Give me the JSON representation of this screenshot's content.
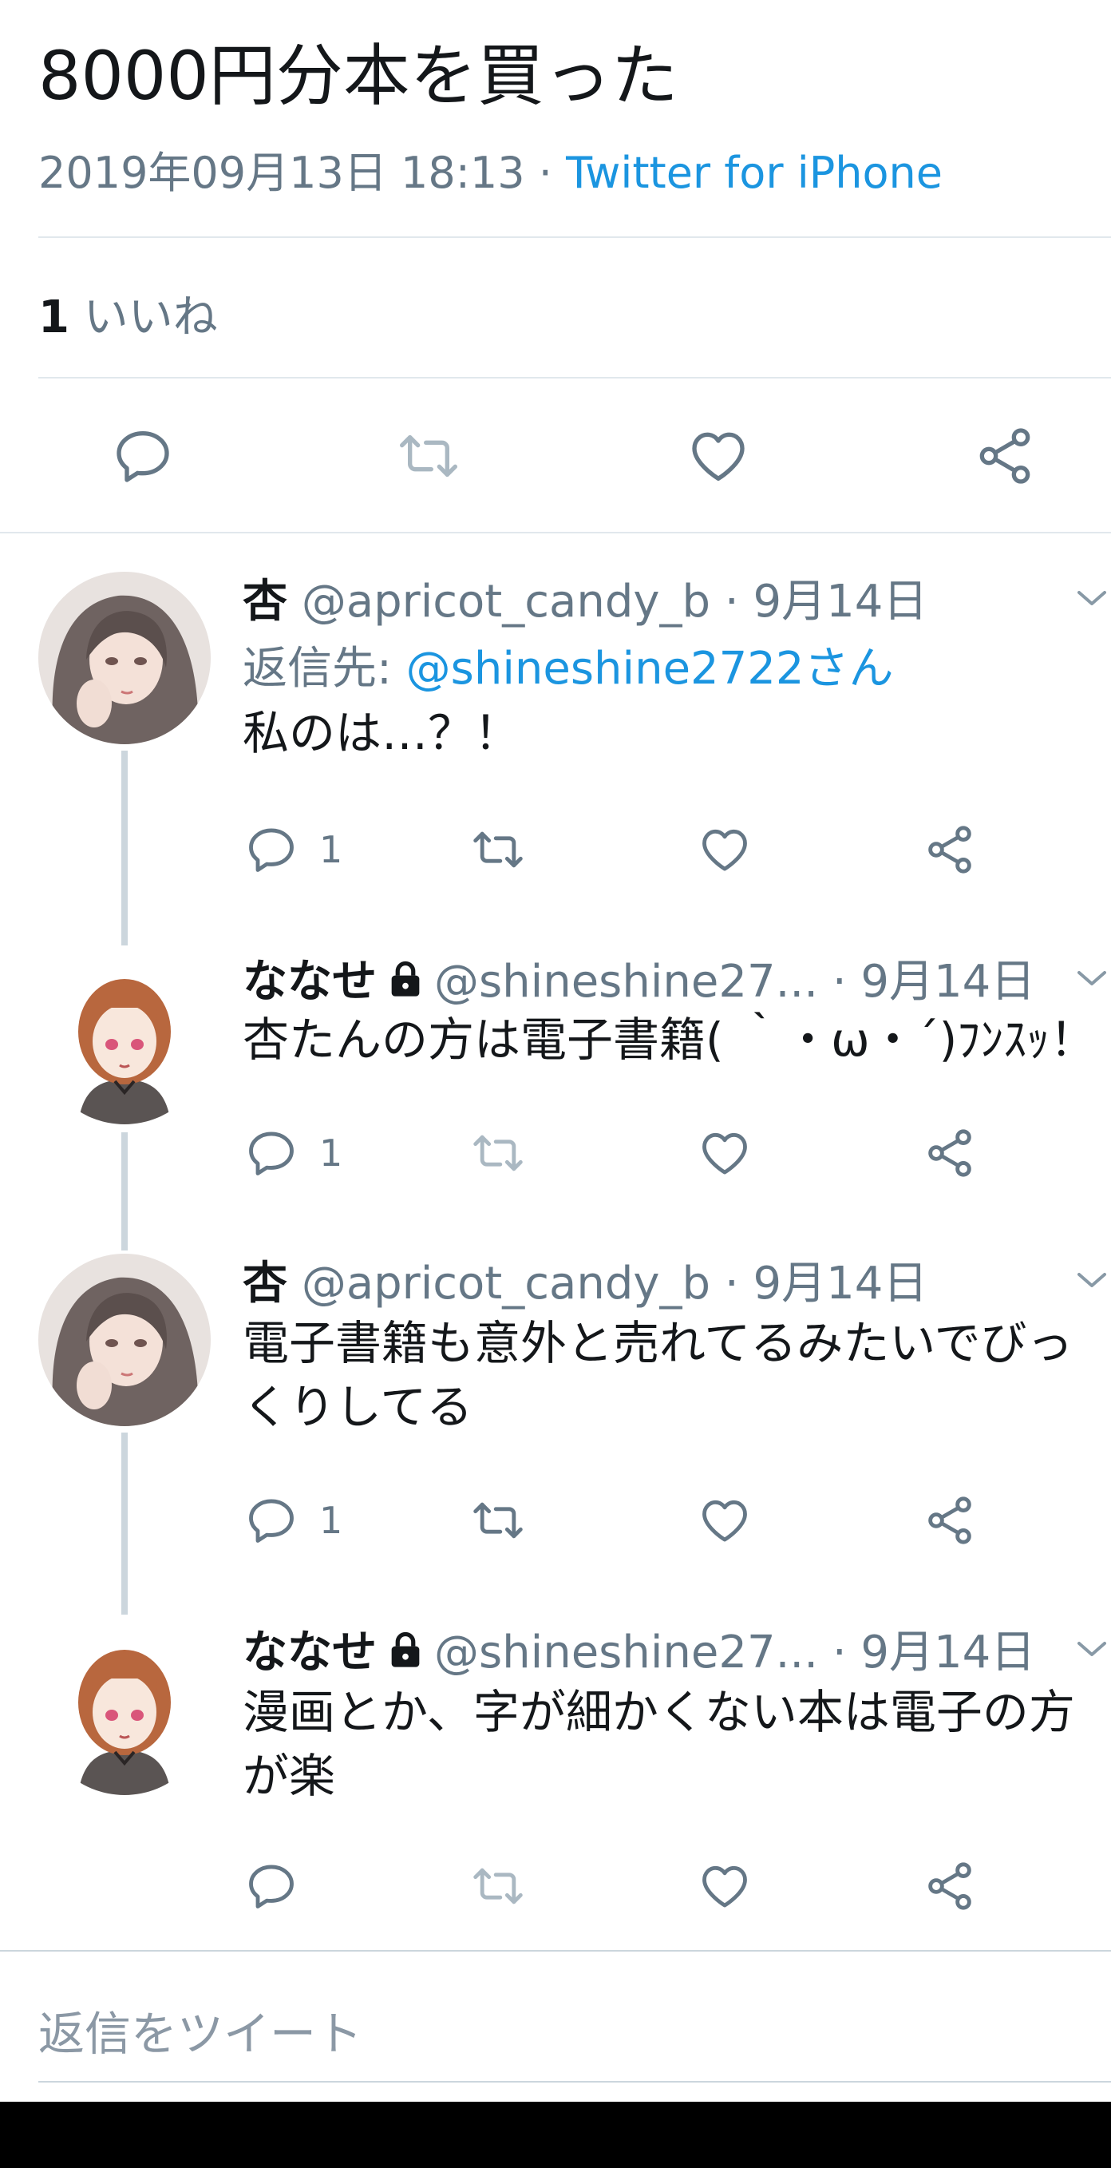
{
  "tweet": {
    "text": "8000円分本を買った",
    "timestamp": "2019年09月13日 18:13",
    "separator": " · ",
    "source": "Twitter for iPhone",
    "like_count": "1",
    "like_label": " いいね"
  },
  "replies": [
    {
      "name": "杏",
      "handle": "@apricot_candy_b",
      "date": " · 9月14日",
      "reply_to_label": "返信先: ",
      "reply_to_mention": "@shineshine2722さん",
      "text": "私のは…？！",
      "reply_count": "1",
      "retweet_enabled": true
    },
    {
      "name": "ななせ",
      "handle": "@shineshine27...",
      "date": " · 9月14日",
      "text": "杏たんの方は電子書籍( ｀・ω・´)ﾌﾝｽｯ！",
      "reply_count": "1",
      "retweet_enabled": false
    },
    {
      "name": "杏",
      "handle": "@apricot_candy_b",
      "date": " · 9月14日",
      "text": "電子書籍も意外と売れてるみたいでびっくりしてる",
      "reply_count": "1",
      "retweet_enabled": true
    },
    {
      "name": "ななせ",
      "handle": "@shineshine27...",
      "date": " · 9月14日",
      "text": "漫画とか、字が細かくない本は電子の方が楽",
      "reply_count": "",
      "retweet_enabled": false
    }
  ],
  "compose": {
    "placeholder": "返信をツイート"
  },
  "icons": [
    "reply-icon",
    "retweet-icon",
    "like-icon",
    "share-icon",
    "lock-icon",
    "chevron-down-icon"
  ],
  "colors": {
    "accent": "#1b95e0",
    "secondary_text": "#657786",
    "border": "#e1e8ed",
    "thread_line": "#ccd6dd",
    "icon": "#657786",
    "icon_disabled": "#aab8c2"
  }
}
